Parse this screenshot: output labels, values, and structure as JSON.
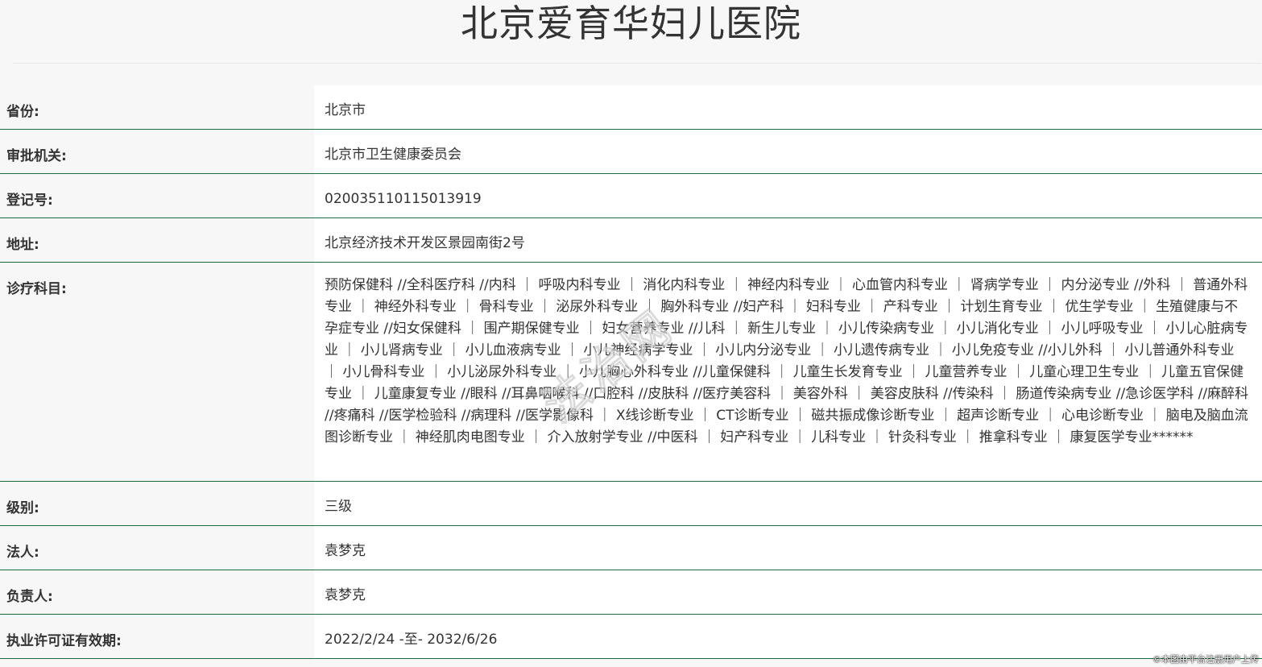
{
  "page": {
    "title": "北京爱育华妇儿医院"
  },
  "rows": [
    {
      "label": "省份:",
      "value": "北京市"
    },
    {
      "label": "审批机关:",
      "value": "北京市卫生健康委员会"
    },
    {
      "label": "登记号:",
      "value": "020035110115013919"
    },
    {
      "label": "地址:",
      "value": "北京经济技术开发区景园南街2号"
    },
    {
      "label": "诊疗科目:",
      "value": "预防保健科 //全科医疗科 //内科 ｜ 呼吸内科专业 ｜ 消化内科专业 ｜ 神经内科专业 ｜ 心血管内科专业 ｜ 肾病学专业 ｜ 内分泌专业 //外科 ｜ 普通外科专业 ｜ 神经外科专业 ｜ 骨科专业 ｜ 泌尿外科专业 ｜ 胸外科专业 //妇产科 ｜ 妇科专业 ｜ 产科专业 ｜ 计划生育专业 ｜ 优生学专业 ｜ 生殖健康与不孕症专业 //妇女保健科 ｜ 围产期保健专业 ｜ 妇女营养专业 //儿科 ｜ 新生儿专业 ｜ 小儿传染病专业 ｜ 小儿消化专业 ｜ 小儿呼吸专业 ｜ 小儿心脏病专业 ｜ 小儿肾病专业 ｜ 小儿血液病专业 ｜ 小儿神经病学专业 ｜ 小儿内分泌专业 ｜ 小儿遗传病专业 ｜ 小儿免疫专业 //小儿外科 ｜ 小儿普通外科专业 ｜ 小儿骨科专业 ｜ 小儿泌尿外科专业 ｜ 小儿胸心外科专业 //儿童保健科 ｜ 儿童生长发育专业 ｜ 儿童营养专业 ｜ 儿童心理卫生专业 ｜ 儿童五官保健专业 ｜ 儿童康复专业 //眼科 //耳鼻咽喉科 //口腔科 //皮肤科 //医疗美容科 ｜ 美容外科 ｜ 美容皮肤科 //传染科 ｜ 肠道传染病专业 //急诊医学科 //麻醉科 //疼痛科 //医学检验科 //病理科 //医学影像科 ｜ X线诊断专业 ｜ CT诊断专业 ｜ 磁共振成像诊断专业 ｜ 超声诊断专业 ｜ 心电诊断专业 ｜ 脑电及脑血流图诊断专业 ｜ 神经肌肉电图专业 ｜ 介入放射学专业 //中医科 ｜ 妇产科专业 ｜ 儿科专业 ｜ 针灸科专业 ｜ 推拿科专业 ｜ 康复医学专业******"
    },
    {
      "label": "级别:",
      "value": "三级"
    },
    {
      "label": "法人:",
      "value": "袁梦克"
    },
    {
      "label": "负责人:",
      "value": "袁梦克"
    },
    {
      "label": "执业许可证有效期:",
      "value": "2022/2/24 -至- 2032/6/26"
    }
  ],
  "watermark": "法治网",
  "footer_note": "©本图由平台注册用户上传"
}
